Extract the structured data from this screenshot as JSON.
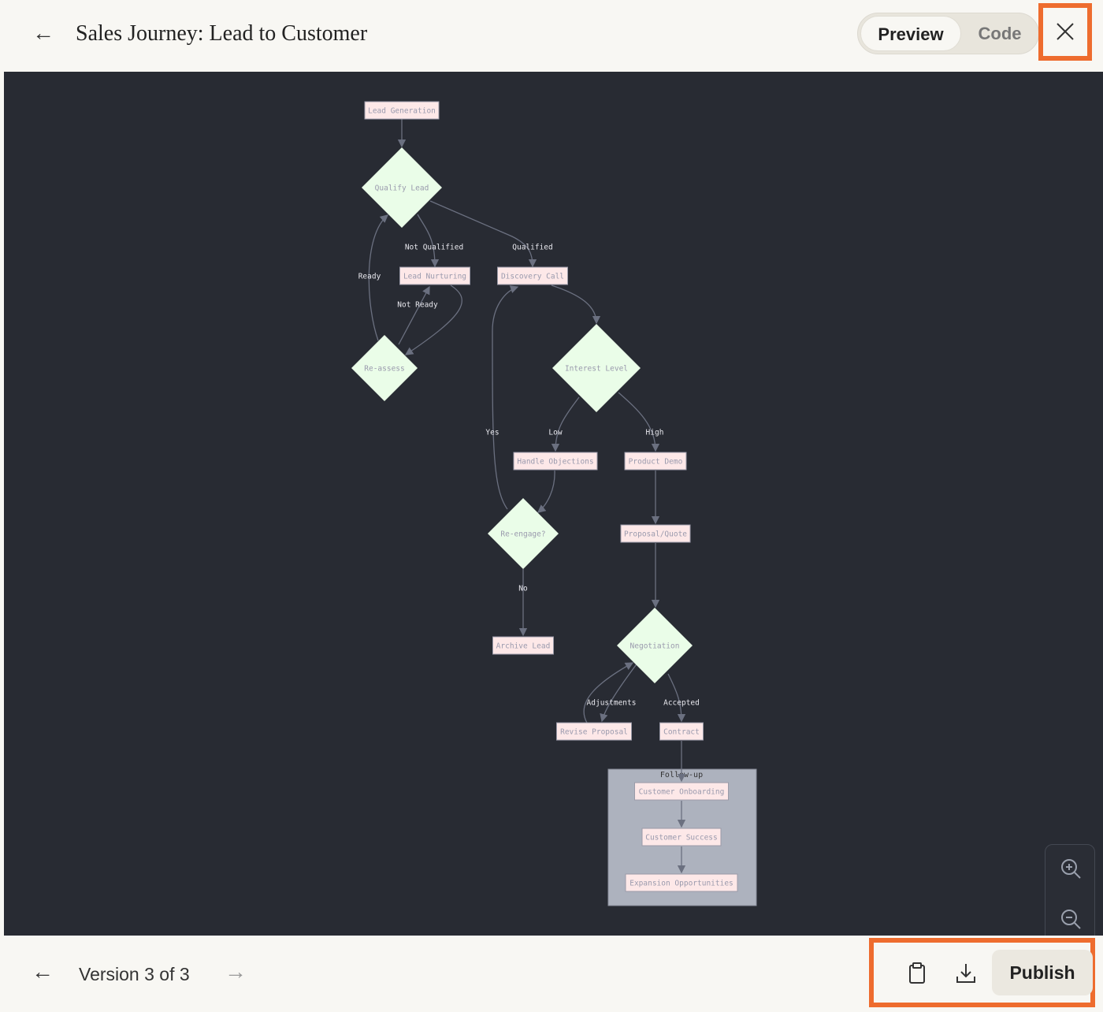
{
  "header": {
    "title": "Sales Journey: Lead to Customer",
    "tabs": [
      {
        "label": "Preview",
        "active": true
      },
      {
        "label": "Code",
        "active": false
      }
    ]
  },
  "footer": {
    "version": "Version 3 of 3",
    "publish": "Publish"
  },
  "colors": {
    "accent": "#ee6c2e",
    "canvas": "#282b33",
    "node_fill": "#fde8e8",
    "decision_fill": "#eafde8",
    "subgraph_fill": "#adb2be",
    "edge": "#6b7080"
  },
  "diagram": {
    "nodes": {
      "lead_generation": "Lead Generation",
      "qualify_lead": "Qualify Lead",
      "lead_nurturing": "Lead Nurturing",
      "discovery_call": "Discovery Call",
      "re_assess": "Re-assess",
      "interest_level": "Interest Level",
      "handle_objections": "Handle Objections",
      "product_demo": "Product Demo",
      "re_engage": "Re-engage?",
      "proposal_quote": "Proposal/Quote",
      "archive_lead": "Archive Lead",
      "negotiation": "Negotiation",
      "revise_proposal": "Revise Proposal",
      "contract": "Contract",
      "customer_onboarding": "Customer Onboarding",
      "customer_success": "Customer Success",
      "expansion_opportunities": "Expansion Opportunities"
    },
    "subgraph": "Follow-up",
    "edge_labels": {
      "not_qualified": "Not Qualified",
      "qualified": "Qualified",
      "ready": "Ready",
      "not_ready": "Not Ready",
      "yes": "Yes",
      "low": "Low",
      "high": "High",
      "no": "No",
      "adjustments": "Adjustments",
      "accepted": "Accepted"
    }
  }
}
